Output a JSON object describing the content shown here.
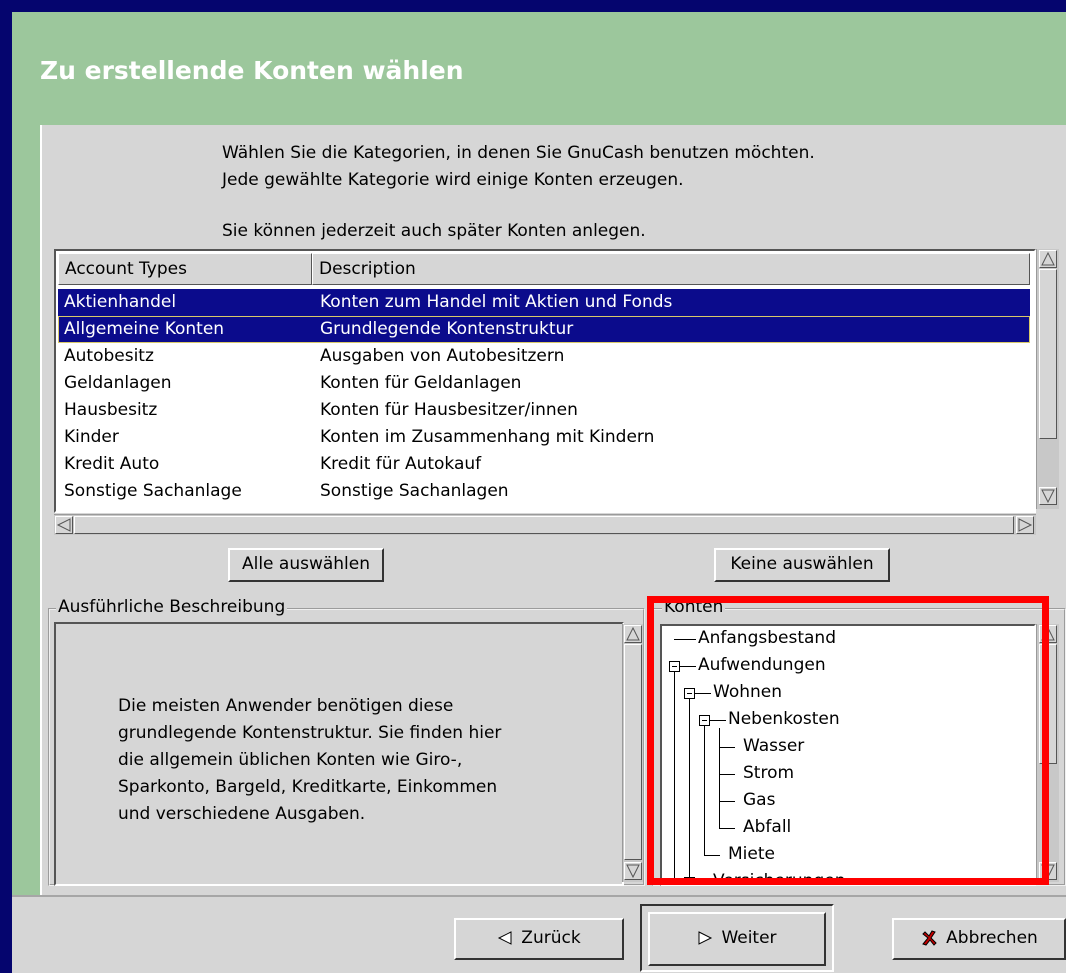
{
  "header": {
    "title": "Zu erstellende Konten wählen"
  },
  "intro": {
    "line1": "Wählen Sie die Kategorien, in denen Sie GnuCash benutzen möchten.",
    "line2": "Jede gewählte Kategorie wird einige Konten erzeugen.",
    "line3": "Sie können jederzeit auch später Konten anlegen."
  },
  "list": {
    "columns": [
      "Account Types",
      "Description"
    ],
    "rows": [
      {
        "type": "Aktienhandel",
        "desc": "Konten zum Handel mit Aktien und Fonds",
        "selected": true
      },
      {
        "type": "Allgemeine Konten",
        "desc": "Grundlegende Kontenstruktur",
        "selected": true
      },
      {
        "type": "Autobesitz",
        "desc": "Ausgaben von Autobesitzern",
        "selected": false
      },
      {
        "type": "Geldanlagen",
        "desc": "Konten für Geldanlagen",
        "selected": false
      },
      {
        "type": "Hausbesitz",
        "desc": "Konten für Hausbesitzer/innen",
        "selected": false
      },
      {
        "type": "Kinder",
        "desc": "Konten im Zusammenhang mit Kindern",
        "selected": false
      },
      {
        "type": "Kredit Auto",
        "desc": "Kredit für Autokauf",
        "selected": false
      },
      {
        "type": "Sonstige Sachanlage",
        "desc": "Sonstige Sachanlagen",
        "selected": false
      }
    ]
  },
  "buttons": {
    "select_all": "Alle auswählen",
    "select_none": "Keine auswählen",
    "back": "Zurück",
    "next": "Weiter",
    "cancel": "Abbrechen"
  },
  "description": {
    "label": "Ausführliche Beschreibung",
    "lines": [
      "Die meisten Anwender benötigen diese",
      "grundlegende Kontenstruktur. Sie finden hier",
      "die allgemein üblichen Konten wie Giro-,",
      "Sparkonto, Bargeld, Kreditkarte, Einkommen",
      "und verschiedene Ausgaben."
    ]
  },
  "accounts": {
    "label": "Konten",
    "tree": [
      {
        "name": "Anfangsbestand",
        "level": 0
      },
      {
        "name": "Aufwendungen",
        "level": 0,
        "expanded": true
      },
      {
        "name": "Wohnen",
        "level": 1,
        "expanded": true
      },
      {
        "name": "Nebenkosten",
        "level": 2,
        "expanded": true
      },
      {
        "name": "Wasser",
        "level": 3
      },
      {
        "name": "Strom",
        "level": 3
      },
      {
        "name": "Gas",
        "level": 3
      },
      {
        "name": "Abfall",
        "level": 3
      },
      {
        "name": "Miete",
        "level": 2
      },
      {
        "name": "Versicherungen",
        "level": 1
      }
    ]
  },
  "colors": {
    "background": "#05056e",
    "header": "#9cc79c",
    "selection": "#0b0b8c",
    "highlight": "#ff0000"
  }
}
